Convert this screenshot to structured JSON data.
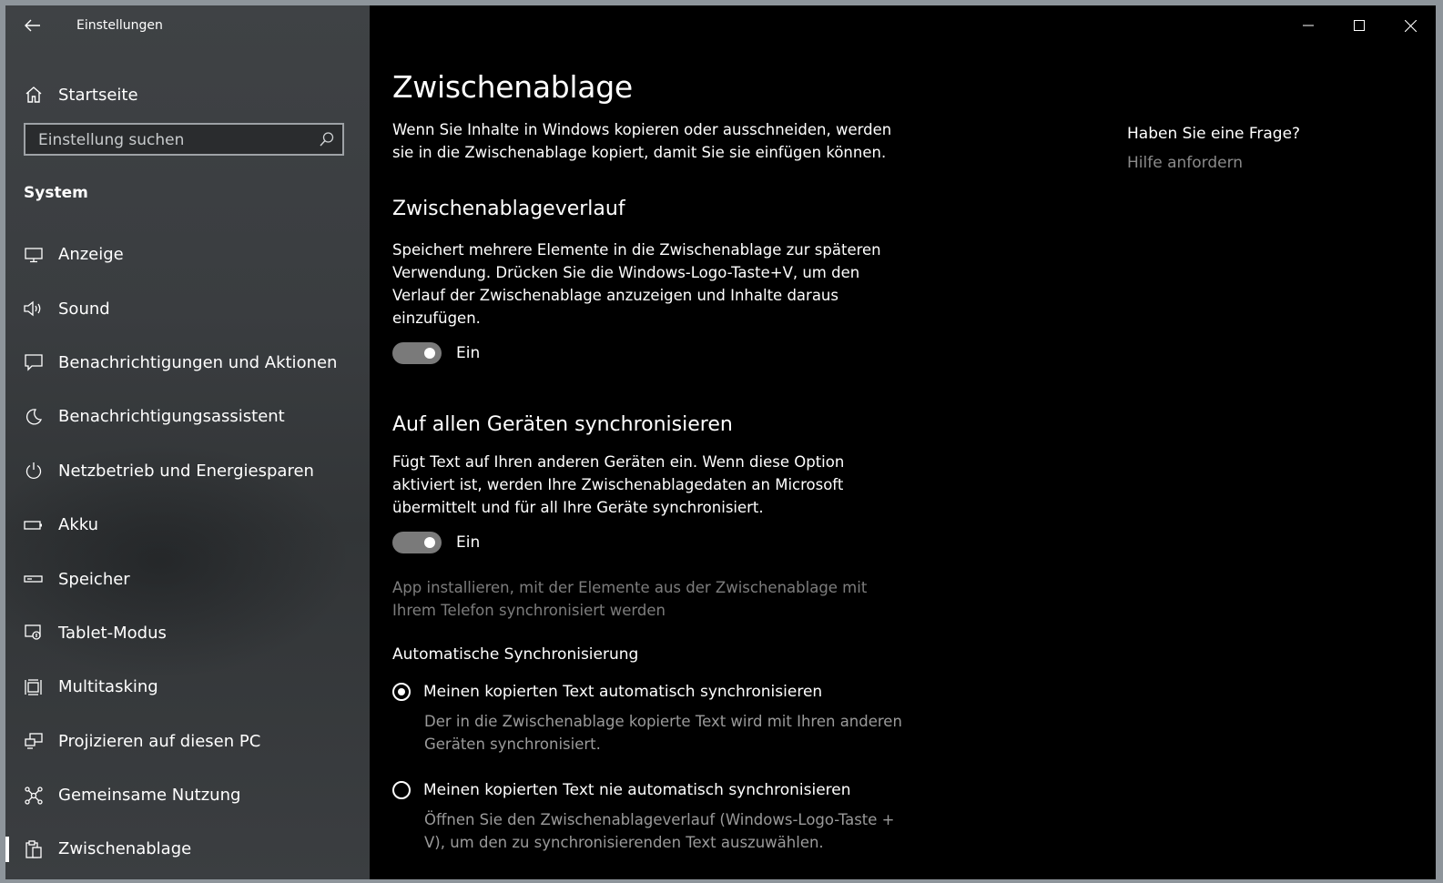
{
  "window": {
    "app_title": "Einstellungen",
    "controls": {
      "minimize_icon": "minimize-icon",
      "maximize_icon": "maximize-icon",
      "close_icon": "close-icon"
    }
  },
  "sidebar": {
    "home_label": "Startseite",
    "search": {
      "placeholder": "Einstellung suchen"
    },
    "section_label": "System",
    "items": [
      {
        "label": "Anzeige",
        "icon": "monitor-icon"
      },
      {
        "label": "Sound",
        "icon": "speaker-icon"
      },
      {
        "label": "Benachrichtigungen und Aktionen",
        "icon": "notification-icon"
      },
      {
        "label": "Benachrichtigungsassistent",
        "icon": "moon-icon"
      },
      {
        "label": "Netzbetrieb und Energiesparen",
        "icon": "power-icon"
      },
      {
        "label": "Akku",
        "icon": "battery-icon"
      },
      {
        "label": "Speicher",
        "icon": "storage-icon"
      },
      {
        "label": "Tablet-Modus",
        "icon": "tablet-icon"
      },
      {
        "label": "Multitasking",
        "icon": "multitasking-icon"
      },
      {
        "label": "Projizieren auf diesen PC",
        "icon": "project-icon"
      },
      {
        "label": "Gemeinsame Nutzung",
        "icon": "share-icon"
      },
      {
        "label": "Zwischenablage",
        "icon": "clipboard-icon",
        "selected": true
      }
    ]
  },
  "main": {
    "title": "Zwischenablage",
    "intro": "Wenn Sie Inhalte in Windows kopieren oder ausschneiden, werden sie in die Zwischenablage kopiert, damit Sie sie einfügen können.",
    "history": {
      "heading": "Zwischenablageverlauf",
      "description": "Speichert mehrere Elemente in die Zwischenablage zur späteren Verwendung. Drücken Sie die Windows-Logo-Taste+V, um den Verlauf der Zwischenablage anzuzeigen und Inhalte daraus einzufügen.",
      "toggle_state": "Ein"
    },
    "sync": {
      "heading": "Auf allen Geräten synchronisieren",
      "description": "Fügt Text auf Ihren anderen Geräten ein. Wenn diese Option aktiviert ist, werden Ihre Zwischenablagedaten an Microsoft übermittelt und für all Ihre Geräte synchronisiert.",
      "toggle_state": "Ein",
      "app_install_text": "App installieren, mit der Elemente aus der Zwischenablage mit Ihrem Telefon synchronisiert werden",
      "auto_sync_label": "Automatische Synchronisierung",
      "options": [
        {
          "label": "Meinen kopierten Text automatisch synchronisieren",
          "description": "Der in die Zwischenablage kopierte Text wird mit Ihren anderen Geräten synchronisiert.",
          "checked": true
        },
        {
          "label": "Meinen kopierten Text nie automatisch synchronisieren",
          "description": "Öffnen Sie den Zwischenablageverlauf (Windows-Logo-Taste + V), um den zu synchronisierenden Text auszuwählen.",
          "checked": false
        }
      ]
    },
    "help": {
      "question": "Haben Sie eine Frage?",
      "link": "Hilfe anfordern"
    }
  }
}
